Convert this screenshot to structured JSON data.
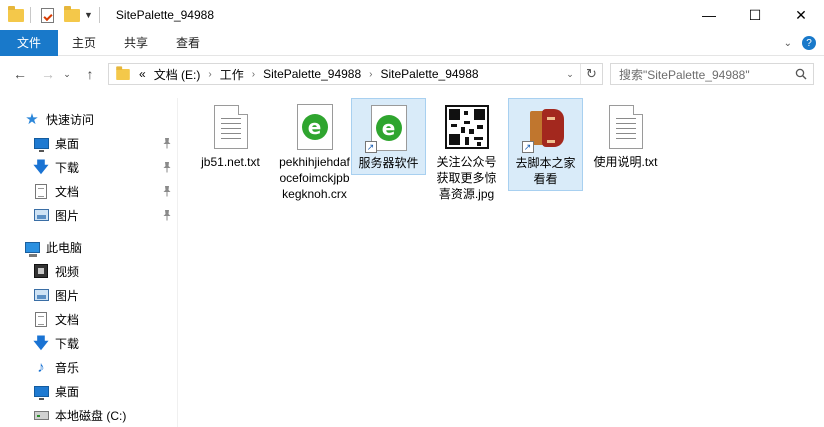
{
  "window": {
    "title": "SitePalette_94988",
    "controls": {
      "minimize": "—",
      "maximize": "☐",
      "close": "✕"
    }
  },
  "ribbon": {
    "file_tab": "文件",
    "tabs": [
      "主页",
      "共享",
      "查看"
    ],
    "help": "?"
  },
  "nav": {
    "back": "←",
    "forward": "→",
    "recent": "⌄",
    "up": "↑",
    "overflow": "«",
    "breadcrumb": [
      "文档 (E:)",
      "工作",
      "SitePalette_94988",
      "SitePalette_94988"
    ],
    "address_dropdown": "⌄",
    "refresh": "↻",
    "search_placeholder": "搜索\"SitePalette_94988\""
  },
  "sidebar": {
    "quick_access": "快速访问",
    "quick_items": [
      "桌面",
      "下载",
      "文档",
      "图片"
    ],
    "this_pc": "此电脑",
    "pc_items": [
      "视频",
      "图片",
      "文档",
      "下载",
      "音乐",
      "桌面",
      "本地磁盘 (C:)"
    ]
  },
  "files": [
    {
      "name": "jb51.net.txt",
      "type": "txt"
    },
    {
      "name": "pekhihjiehdafocefoimckjpbkegknoh.crx",
      "type": "crx"
    },
    {
      "name": "服务器软件",
      "type": "shortcut-ie",
      "selected": true
    },
    {
      "name": "关注公众号获取更多惊喜资源.jpg",
      "type": "qr"
    },
    {
      "name": "去脚本之家看看",
      "type": "shortcut-jb",
      "selected": true
    },
    {
      "name": "使用说明.txt",
      "type": "txt"
    }
  ],
  "colors": {
    "accent": "#1979ca",
    "selection": "#d9ebf9"
  }
}
